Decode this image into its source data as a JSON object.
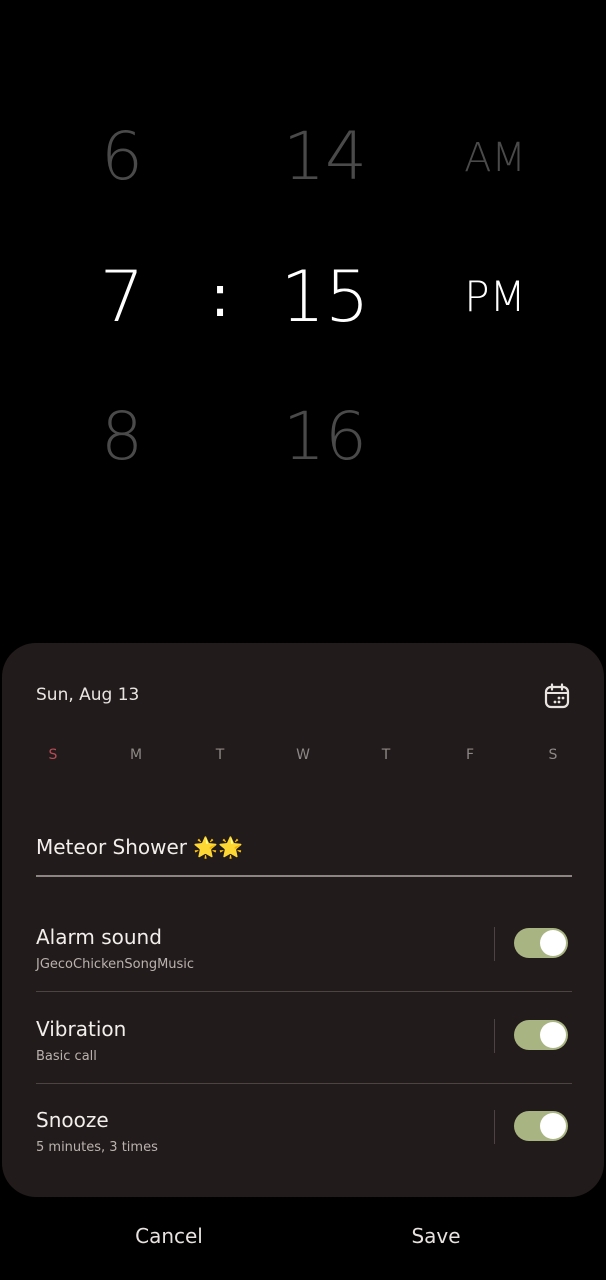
{
  "picker": {
    "hour_prev": "6",
    "hour_sel": "7",
    "hour_next": "8",
    "separator": ":",
    "min_prev": "14",
    "min_sel": "15",
    "min_next": "16",
    "ampm_prev": "AM",
    "ampm_sel": "PM"
  },
  "card": {
    "date": "Sun, Aug 13",
    "calendar_icon": "calendar-icon",
    "weekdays": [
      "S",
      "M",
      "T",
      "W",
      "T",
      "F",
      "S"
    ],
    "alarm_name": "Meteor Shower 🌟🌟",
    "settings": [
      {
        "title": "Alarm sound",
        "subtitle": "JGecoChickenSongMusic",
        "enabled": true
      },
      {
        "title": "Vibration",
        "subtitle": "Basic call",
        "enabled": true
      },
      {
        "title": "Snooze",
        "subtitle": "5 minutes, 3 times",
        "enabled": true
      }
    ]
  },
  "footer": {
    "cancel": "Cancel",
    "save": "Save"
  },
  "colors": {
    "background": "#000000",
    "card": "#221b1b",
    "toggle_on": "#a8b482",
    "sunday": "#b54b55"
  }
}
